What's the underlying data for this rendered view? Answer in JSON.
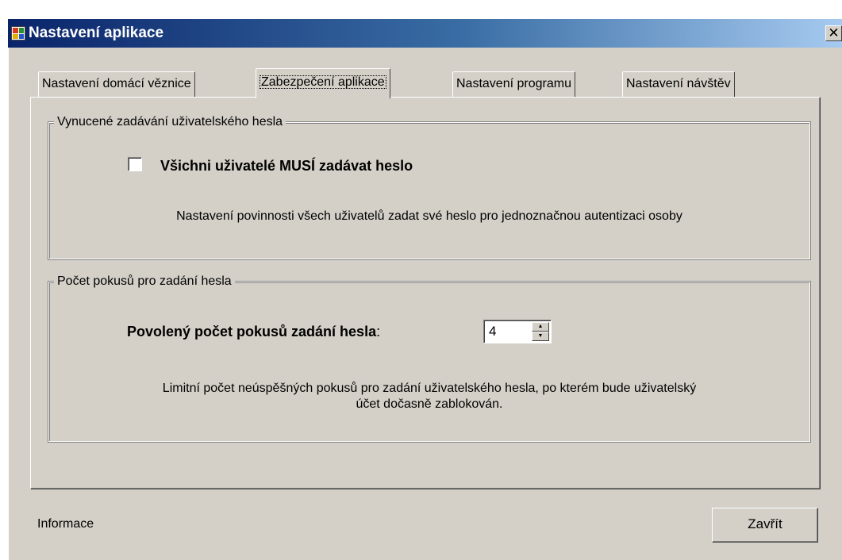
{
  "window": {
    "title": "Nastavení aplikace",
    "close_glyph": "✕"
  },
  "tabs": [
    {
      "label": "Nastavení domácí věznice",
      "active": false
    },
    {
      "label": "Zabezpečení aplikace",
      "active": true
    },
    {
      "label": "Nastavení programu",
      "active": false
    },
    {
      "label": "Nastavení návštěv",
      "active": false
    }
  ],
  "group_password": {
    "title": "Vynucené zadávání uživatelského hesla",
    "checkbox_label": "Všichni uživatelé MUSÍ zadávat heslo",
    "checked": false,
    "description": "Nastavení povinnosti všech uživatelů zadat své heslo pro jednoznačnou autentizaci osoby"
  },
  "group_attempts": {
    "title": "Počet pokusů pro zadání hesla",
    "label": "Povolený počet pokusů zadání hesla",
    "colon": ":",
    "value": "4",
    "description_line1": "Limitní počet neúspěšných pokusů pro zadání uživatelského hesla, po kterém bude uživatelský",
    "description_line2": "účet dočasně zablokován."
  },
  "footer": {
    "info_label": "Informace",
    "close_label": "Zavřít"
  },
  "icons": {
    "window_icon": "app-icon",
    "spin_up": "▲",
    "spin_down": "▼"
  }
}
